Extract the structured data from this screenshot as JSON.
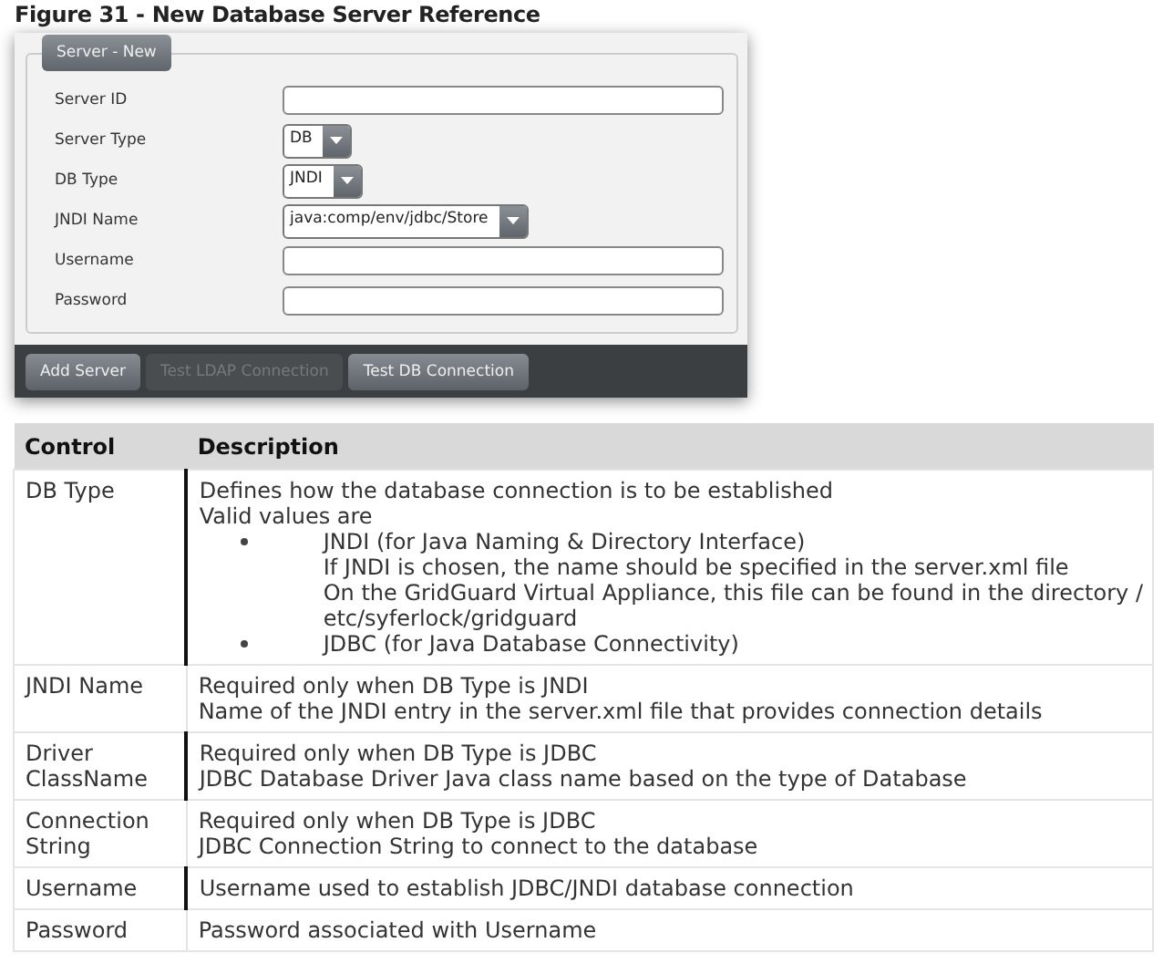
{
  "figure_caption": "Figure 31 - New Database Server Reference",
  "form": {
    "legend": "Server - New",
    "fields": [
      {
        "label": "Server ID",
        "kind": "text"
      },
      {
        "label": "Server Type",
        "kind": "select",
        "value": "DB"
      },
      {
        "label": "DB Type",
        "kind": "select",
        "value": "JNDI"
      },
      {
        "label": "JNDI Name",
        "kind": "select",
        "value": "java:comp/env/jdbc/Store"
      },
      {
        "label": "Username",
        "kind": "text"
      },
      {
        "label": "Password",
        "kind": "text"
      }
    ],
    "buttons": [
      {
        "label": "Add Server",
        "disabled": false
      },
      {
        "label": "Test LDAP Connection",
        "disabled": true
      },
      {
        "label": "Test DB Connection",
        "disabled": false
      }
    ]
  },
  "table": {
    "columns": [
      "Control",
      "Description"
    ],
    "rows": [
      {
        "control": "DB Type",
        "left_rule": true,
        "lines": [
          "Defines how the database connection is to be established",
          "Valid values are"
        ],
        "bullets": [
          {
            "text": "JNDI (for Java Naming & Directory Interface)",
            "lines": [
              "If JNDI is chosen, the name should be specified in the server.xml file",
              "On the GridGuard Virtual Appliance, this file can be found in the directory /",
              "etc/syferlock/gridguard"
            ]
          },
          {
            "text": "JDBC (for Java Database Connectivity)"
          }
        ]
      },
      {
        "control": "JNDI Name",
        "left_rule": false,
        "lines": [
          "Required only when DB Type is JNDI",
          "Name of the JNDI entry in the server.xml file that provides connection details"
        ]
      },
      {
        "control": "Driver ClassName",
        "left_rule": true,
        "lines": [
          "Required only when DB Type is JDBC",
          "JDBC Database Driver Java class name based on the type of Database"
        ]
      },
      {
        "control": "Connection String",
        "left_rule": false,
        "lines": [
          "Required only when DB Type is JDBC",
          "JDBC Connection String to connect to the database"
        ]
      },
      {
        "control": "Username",
        "left_rule": true,
        "lines": [
          "Username used to establish JDBC/JNDI database connection"
        ]
      },
      {
        "control": "Password",
        "left_rule": false,
        "lines": [
          "Password associated with Username"
        ]
      }
    ]
  }
}
